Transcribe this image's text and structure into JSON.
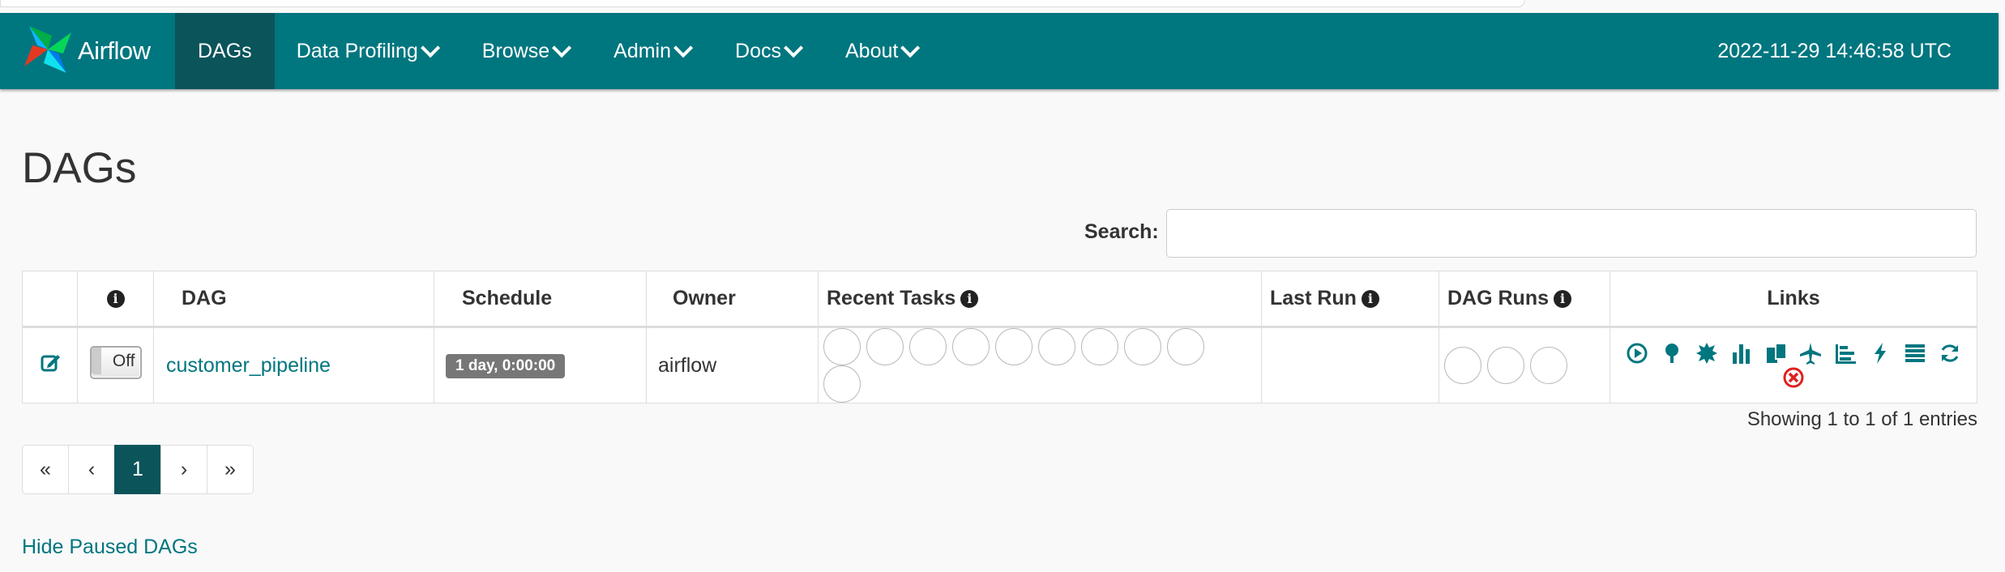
{
  "brand": {
    "name": "Airflow",
    "logo_icon": "pinwheel-logo-icon"
  },
  "nav": {
    "items": [
      {
        "label": "DAGs",
        "dropdown": false,
        "active": true
      },
      {
        "label": "Data Profiling",
        "dropdown": true
      },
      {
        "label": "Browse",
        "dropdown": true
      },
      {
        "label": "Admin",
        "dropdown": true
      },
      {
        "label": "Docs",
        "dropdown": true
      },
      {
        "label": "About",
        "dropdown": true
      }
    ],
    "datetime": "2022-11-29 14:46:58 UTC"
  },
  "page": {
    "title": "DAGs"
  },
  "search": {
    "label": "Search:",
    "value": ""
  },
  "table": {
    "headers": {
      "edit": "",
      "toggle_info": "i",
      "dag": "DAG",
      "schedule": "Schedule",
      "owner": "Owner",
      "recent_tasks": "Recent Tasks",
      "last_run": "Last Run",
      "dag_runs": "DAG Runs",
      "links": "Links"
    },
    "rows": [
      {
        "toggle": "Off",
        "dag_id": "customer_pipeline",
        "schedule": "1 day, 0:00:00",
        "owner": "airflow",
        "last_run": "",
        "recent_task_circles": 10,
        "dag_run_circles": 3
      }
    ],
    "link_icons": [
      "trigger-dag-icon",
      "tree-view-icon",
      "graph-view-icon",
      "task-duration-icon",
      "task-tries-icon",
      "landing-times-icon",
      "gantt-icon",
      "code-icon",
      "logs-icon",
      "refresh-icon",
      "delete-icon"
    ]
  },
  "pagination": {
    "first": "«",
    "prev": "‹",
    "current": "1",
    "next": "›",
    "last": "»",
    "summary": "Showing 1 to 1 of 1 entries"
  },
  "footer": {
    "hide_paused": "Hide Paused DAGs"
  },
  "colors": {
    "navbar": "#00767f",
    "active_nav": "#0b545a",
    "link": "#00767f",
    "delete": "#e02020"
  }
}
